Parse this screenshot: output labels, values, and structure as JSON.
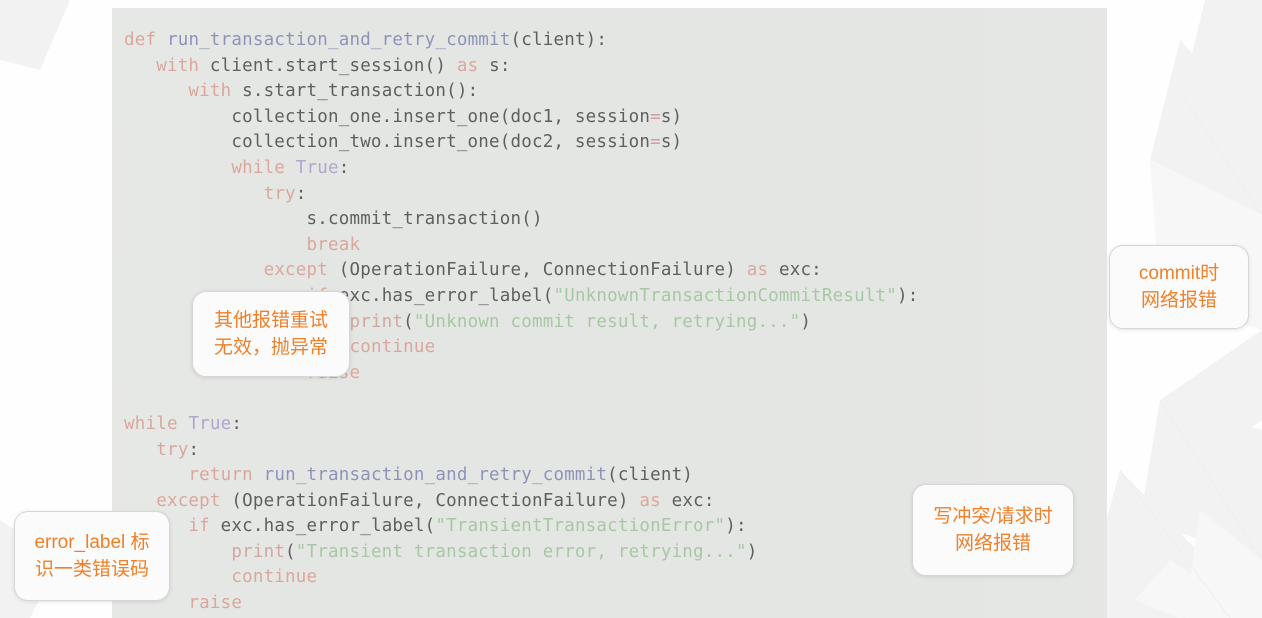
{
  "slide": {
    "background_color": "#fefefe",
    "code_panel_color": "#e4e6e3",
    "accent_color": "#ef7f28"
  },
  "code": {
    "language": "python",
    "font": "monospace",
    "lines": [
      "def run_transaction_and_retry_commit(client):",
      "   with client.start_session() as s:",
      "      with s.start_transaction():",
      "          collection_one.insert_one(doc1, session=s)",
      "          collection_two.insert_one(doc2, session=s)",
      "          while True:",
      "             try:",
      "                 s.commit_transaction()",
      "                 break",
      "             except (OperationFailure, ConnectionFailure) as exc:",
      "                 if exc.has_error_label(\"UnknownTransactionCommitResult\"):",
      "                     print(\"Unknown commit result, retrying...\")",
      "                     continue",
      "                 raise",
      "",
      "while True:",
      "   try:",
      "      return run_transaction_and_retry_commit(client)",
      "   except (OperationFailure, ConnectionFailure) as exc:",
      "      if exc.has_error_label(\"TransientTransactionError\"):",
      "          print(\"Transient transaction error, retrying...\")",
      "          continue",
      "      raise"
    ],
    "function_name": "run_transaction_and_retry_commit",
    "exception_types": [
      "OperationFailure",
      "ConnectionFailure"
    ],
    "error_labels": [
      "UnknownTransactionCommitResult",
      "TransientTransactionError"
    ],
    "printed_messages": [
      "Unknown commit result, retrying...",
      "Transient transaction error, retrying..."
    ]
  },
  "callouts": {
    "other_errors": {
      "line1": "其他报错重试",
      "line2": "无效，抛异常",
      "color": "#ef7f28"
    },
    "commit_network": {
      "line1": "commit时",
      "line2": "网络报错",
      "color": "#ef7f28"
    },
    "error_label": {
      "line1": "error_label 标",
      "line2": "识一类错误码",
      "color": "#ef7f28"
    },
    "write_conflict": {
      "line1": "写冲突/请求时",
      "line2": "网络报错",
      "color": "#ef7f28"
    }
  }
}
